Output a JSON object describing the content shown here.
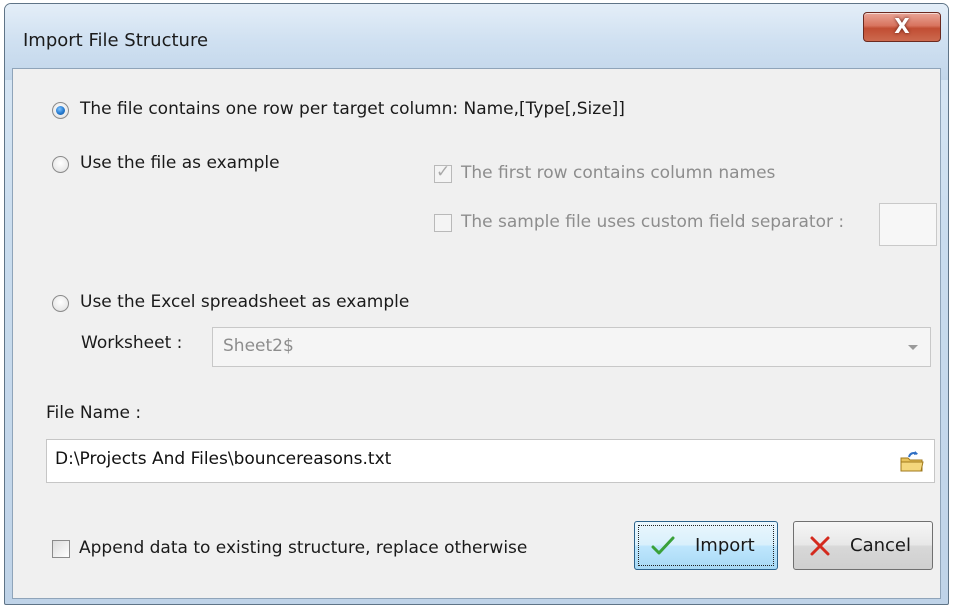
{
  "window": {
    "title": "Import File Structure",
    "close_label": "X"
  },
  "options": {
    "row_per_column": {
      "label": "The file contains one row per target column: Name,[Type[,Size]]",
      "selected": true
    },
    "file_example": {
      "label": "Use the file as example",
      "selected": false
    },
    "first_row_names": {
      "label": "The first row contains column names",
      "checked": true,
      "enabled": false
    },
    "custom_separator": {
      "label": "The sample file uses custom field separator :",
      "checked": false,
      "enabled": false,
      "value": ""
    },
    "excel_example": {
      "label": "Use the Excel spreadsheet as example",
      "selected": false
    }
  },
  "worksheet": {
    "label": "Worksheet :",
    "value": "Sheet2$"
  },
  "file_name": {
    "label": "File Name :",
    "value": "D:\\Projects And Files\\bouncereasons.txt"
  },
  "append": {
    "label": "Append data to existing structure, replace otherwise",
    "checked": false
  },
  "buttons": {
    "import_label": "Import",
    "cancel_label": "Cancel"
  },
  "colors": {
    "import_check": "#3aa13a",
    "cancel_x": "#d42a1e"
  }
}
